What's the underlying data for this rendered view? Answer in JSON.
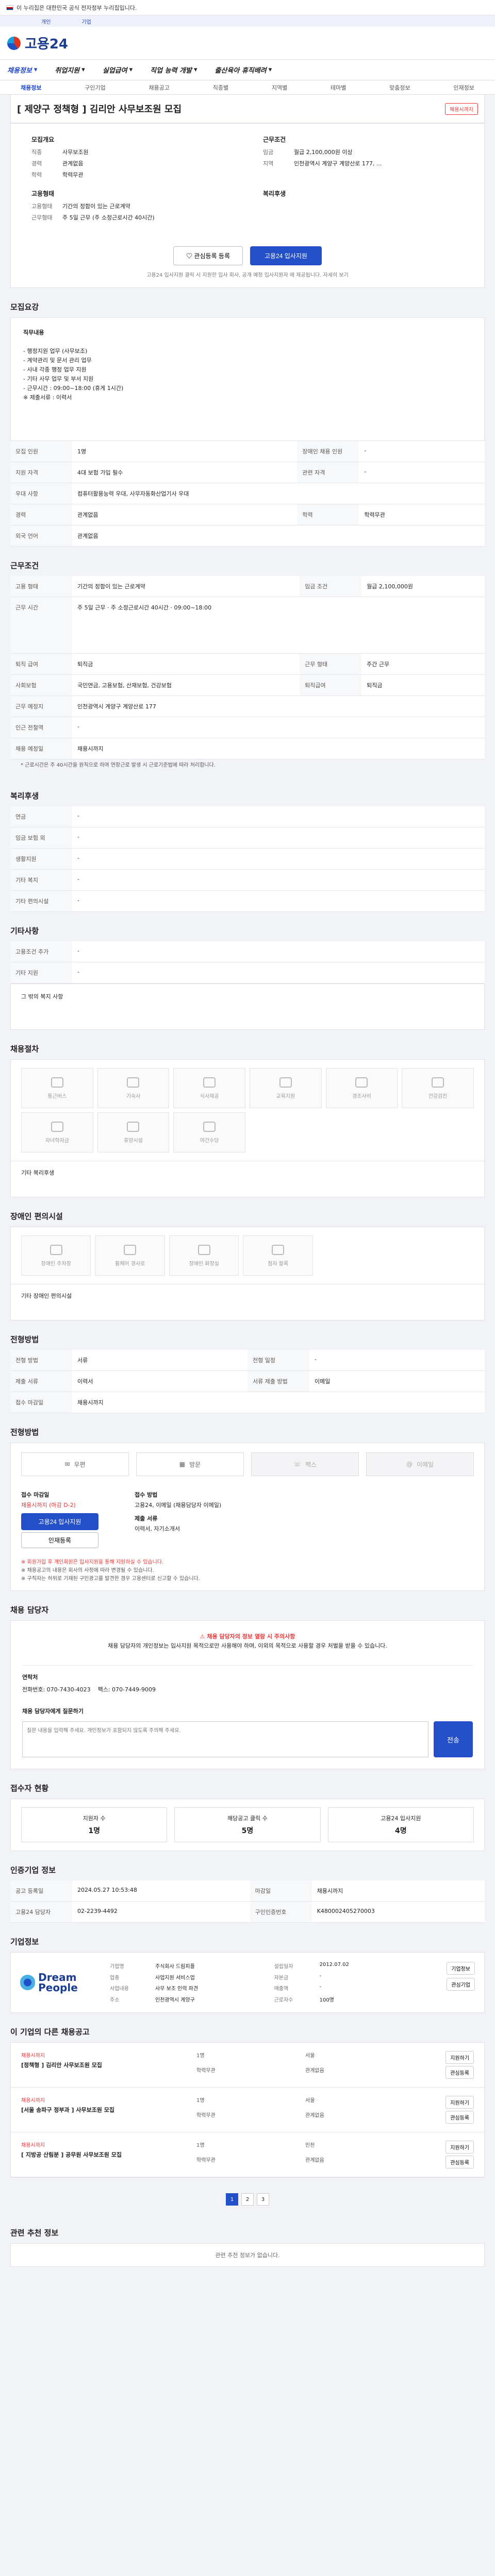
{
  "gov": {
    "text": "이 누리집은 대한민국 공식 전자정부 누리집입니다.",
    "links": [
      "개인",
      "기업"
    ]
  },
  "brand": {
    "name": "고용24"
  },
  "nav": {
    "items": [
      "채용정보",
      "취업지원",
      "실업급여",
      "직업 능력 개발",
      "출산육아 휴직배려"
    ],
    "sub": [
      "채용정보",
      "구인기업",
      "채용공고",
      "직종별",
      "지역별",
      "테마별",
      "맞춤정보",
      "인재정보"
    ]
  },
  "job": {
    "title": "[ 제양구 정책형 ] 김리안 사무보조원 모집",
    "badge": "채용시까지",
    "company_head": "모집개요",
    "company_kv": [
      [
        "직종",
        "사무보조원"
      ],
      [
        "경력",
        "관계없음"
      ],
      [
        "학력",
        "학력무관"
      ]
    ],
    "work_head": "근무조건",
    "work_kv": [
      [
        "임금",
        "월급 2,100,000원 이상"
      ],
      [
        "지역",
        "인천광역시 계양구 계양산로 177, ..."
      ]
    ],
    "welfare_head": "고용형태",
    "welfare_kv": [
      [
        "고용형태",
        "기간의 정함이 있는 근로계약"
      ],
      [
        "근무형태",
        "주 5일 근무 (주 소정근로시간 40시간)"
      ]
    ],
    "status_head": "복리후생",
    "interest_btn": "관심등록 등록",
    "apply_btn": "고용24 입사지원",
    "apply_notice": "고용24 입사지원 클릭 시 지원한 입사 회사, 공개 예정 입사지원자 에 제공됩니다. 자세히 보기"
  },
  "sections": {
    "recruit": "모집요강",
    "work": "근무조건",
    "welfare": "복리후생",
    "disability": "장애인 편의시설",
    "etc": "기타사항",
    "hiring": "채용절차",
    "apply": "전형방법",
    "contact": "채용 담당자",
    "status": "접수자 현황",
    "info": "인증기업 정보",
    "company": "기업정보",
    "other_jobs": "이 기업의 다른 채용공고",
    "related": "관련 추천 정보"
  },
  "recruit": {
    "desc_title": "직무내용",
    "desc_lines": [
      "- 행정지원 업무 (사무보조)",
      "- 계약관리 및 문서 관리 업무",
      "- 사내 각종 행정 업무 지원",
      "- 기타 사무 업무 및 부서 지원",
      "- 근무시간 : 09:00~18:00 (휴게 1시간)",
      "※ 제출서류 : 이력서"
    ],
    "rows": [
      [
        "모집 인원",
        "1명",
        "장애인 채용 인원",
        "-"
      ],
      [
        "지원 자격",
        "4대 보험 가입 필수",
        "관련 자격",
        "-"
      ],
      [
        "우대 사항",
        "컴퓨터활용능력 우대, 사무자동화산업기사 우대",
        "",
        ""
      ],
      [
        "경력",
        "관계없음",
        "학력",
        "학력무관"
      ],
      [
        "외국 언어",
        "관계없음",
        "",
        ""
      ]
    ]
  },
  "work": {
    "rows": [
      [
        "고용 형태",
        "기간의 정함이 있는 근로계약",
        "임금 조건",
        "월급 2,100,000원"
      ],
      [
        "근무 시간",
        "주 5일 근무 · 주 소정근로시간 40시간 · 09:00~18:00",
        "",
        ""
      ],
      [
        "퇴직 급여",
        "퇴직금",
        "근무 형태",
        "주간 근무"
      ],
      [
        "사회보험",
        "국민연금, 고용보험, 산재보험, 건강보험",
        "퇴직급여",
        "퇴직금"
      ],
      [
        "근무 예정지",
        "인천광역시 계양구 계양산로 177",
        "",
        ""
      ],
      [
        "인근 전철역",
        "-",
        "",
        ""
      ],
      [
        "채용 예정일",
        "채용시까지",
        "",
        ""
      ]
    ],
    "note": "* 근로시간은 주 40시간을 원칙으로 하며 연장근로 발생 시 근로기준법에 따라 처리합니다."
  },
  "welfare_rows": [
    [
      "연금",
      "-"
    ],
    [
      "임금 보험 외",
      "-"
    ],
    [
      "생활지원",
      "-"
    ],
    [
      "기타 복지",
      "-"
    ],
    [
      "기타 편의시설",
      "-"
    ]
  ],
  "etc_rows": [
    [
      "고용조건 추가",
      "-"
    ],
    [
      "기타 지원",
      "-"
    ]
  ],
  "etc_note": "그 밖의 복지 사항",
  "hiring_icons": [
    "통근버스",
    "기숙사",
    "식사제공",
    "교육지원",
    "경조사비",
    "건강검진",
    "자녀학자금",
    "휴양시설",
    "야간수당"
  ],
  "hiring_note": "기타 복리후생",
  "disability_icons": [
    "장애인 주차장",
    "휠체어 경사로",
    "장애인 화장실",
    "점자 블록"
  ],
  "disability_note": "기타 장애인 편의시설",
  "apply_rows": [
    [
      "전형 방법",
      "서류",
      "전형 일정",
      "-"
    ],
    [
      "제출 서류",
      "이력서",
      "서류 제출 방법",
      "이메일"
    ],
    [
      "접수 마감일",
      "채용시까지",
      "",
      ""
    ]
  ],
  "method_cards": [
    "우편",
    "방문",
    "팩스",
    "이메일"
  ],
  "apply_box": {
    "left_title": "접수 마감일",
    "left_value": "채용시까지 (마감 D-2)",
    "left_btn": "고용24 입사지원",
    "left_btn2": "인재등록",
    "right_title": "접수 방법",
    "right_value": "고용24, 이메일 (채용담당자 이메일)",
    "right_sub": "제출 서류",
    "right_sub_value": "이력서, 자기소개서"
  },
  "apply_notes": [
    "※ 회원가입 후 개인회원은 입사지원을 통해 지원하실 수 있습니다.",
    "※ 채용공고의 내용은 회사의 사정에 따라 변경될 수 있습니다.",
    "※ 구직자는 허위로 기재된 구인광고를 발견한 경우 고용센터로 신고할 수 있습니다."
  ],
  "contact": {
    "notice_red": "채용 담당자의 정보 열람 시 주의사항",
    "notice": "채용 담당자의 개인정보는 입사지원 목적으로만 사용해야 하며, 이외의 목적으로 사용할 경우 처벌을 받을 수 있습니다.",
    "phone_label": "연락처",
    "phone": "전화번호: 070-7430-4023",
    "fax": "팩스: 070-7449-9009",
    "inquiry_label": "채용 담당자에게 질문하기",
    "inquiry_placeholder": "질문 내용을 입력해 주세요. 개인정보가 포함되지 않도록 주의해 주세요.",
    "inquiry_btn": "전송"
  },
  "status_cards": [
    [
      "지원자 수",
      "1명"
    ],
    [
      "해당공고 클릭 수",
      "5명"
    ],
    [
      "고용24 입사지원",
      "4명"
    ]
  ],
  "info_rows": [
    [
      "공고 등록일",
      "2024.05.27 10:53:48",
      "마감일",
      "채용시까지"
    ],
    [
      "고용24 담당자",
      "02-2239-4492",
      "구인인증번호",
      "K480002405270003"
    ]
  ],
  "company": {
    "logo": "Dream People",
    "kv": [
      [
        "기업명",
        "주식회사 드림피플"
      ],
      [
        "설립일자",
        "2012.07.02"
      ],
      [
        "업종",
        "사업지원 서비스업"
      ],
      [
        "자본금",
        "-"
      ],
      [
        "사업내용",
        "사무 보조 인력 파견"
      ],
      [
        "매출액",
        "-"
      ],
      [
        "주소",
        "인천광역시 계양구"
      ],
      [
        "근로자수",
        "100명"
      ]
    ],
    "btn1": "기업정보",
    "btn2": "관심기업"
  },
  "other_jobs": [
    {
      "co": "채용시까지",
      "title": "[정책형 ] 김리안 사무보조원 모집",
      "meta": [
        "1명",
        "서울",
        "학력무관",
        "관계없음"
      ]
    },
    {
      "co": "채용시까지",
      "title": "[서울 송파구 정부과 ] 사무보조원 모집",
      "meta": [
        "1명",
        "서울",
        "학력무관",
        "관계없음"
      ]
    },
    {
      "co": "채용시까지",
      "title": "[ 지방공 산림분 ] 공무원 사무보조원 모집",
      "meta": [
        "1명",
        "인천",
        "학력무관",
        "관계없음"
      ]
    }
  ],
  "other_btns": [
    "지원하기",
    "관심등록"
  ],
  "pages": [
    "1",
    "2",
    "3"
  ],
  "related_note": "관련 추천 정보가 없습니다."
}
